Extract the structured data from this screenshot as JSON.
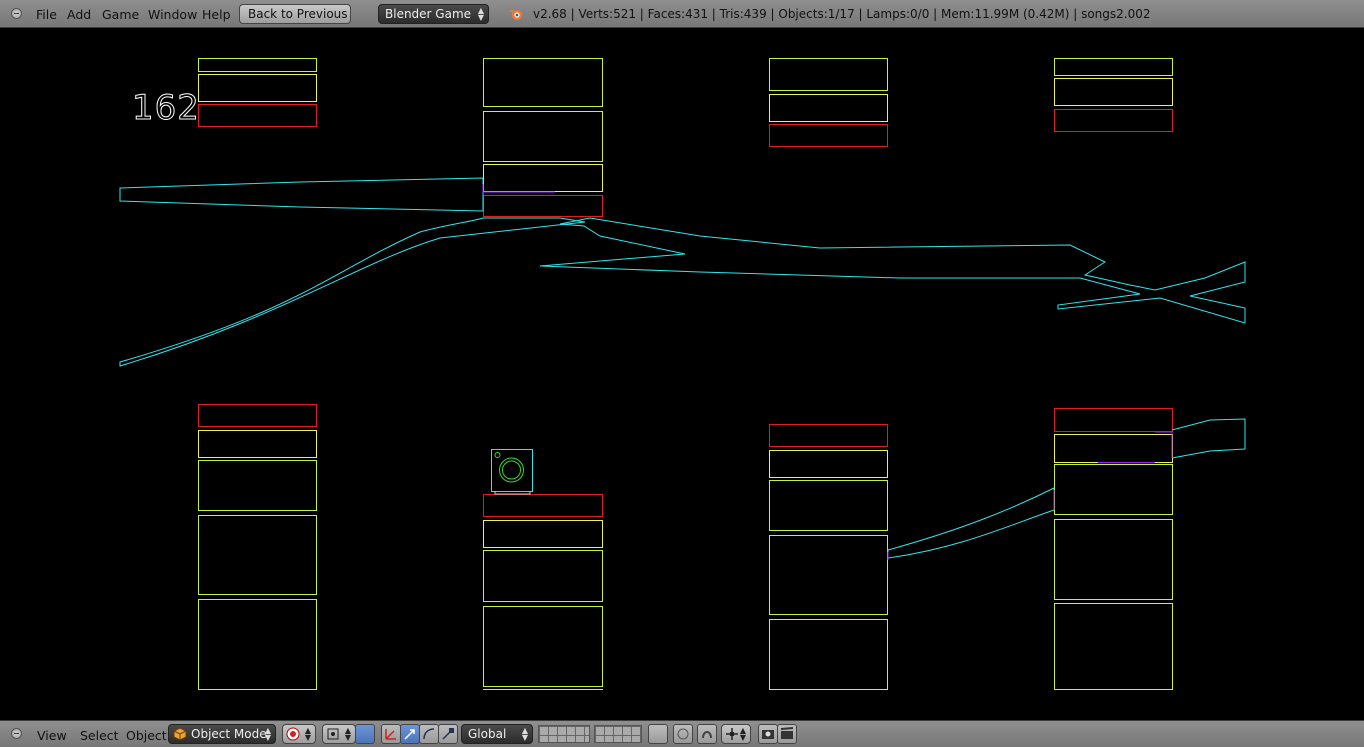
{
  "header": {
    "menus": [
      "File",
      "Add",
      "Game",
      "Window",
      "Help"
    ],
    "back_button": "Back to Previous",
    "engine_select": "Blender Game",
    "stats": "v2.68 | Verts:521 | Faces:431 | Tris:439 | Objects:1/17 | Lamps:0/0 | Mem:11.99M (0.42M) | songs2.002"
  },
  "viewport": {
    "frame_counter": "162"
  },
  "footer": {
    "menus": [
      "View",
      "Select",
      "Object"
    ],
    "mode_select": "Object Mode",
    "orientation_select": "Global"
  },
  "colors": {
    "background": "#000000",
    "lime_outline": "#c8f03c",
    "yellow_outline": "#f0f05a",
    "red_outline": "#e01e1e",
    "cyan_outline": "#2ee6f0",
    "purple_outline": "#9a22ff",
    "green_outline": "#2fdc2f",
    "header_gray": "#858585"
  },
  "icons": {
    "blender_logo": "blender-logo-icon",
    "camera_object": "camera-object-icon"
  }
}
